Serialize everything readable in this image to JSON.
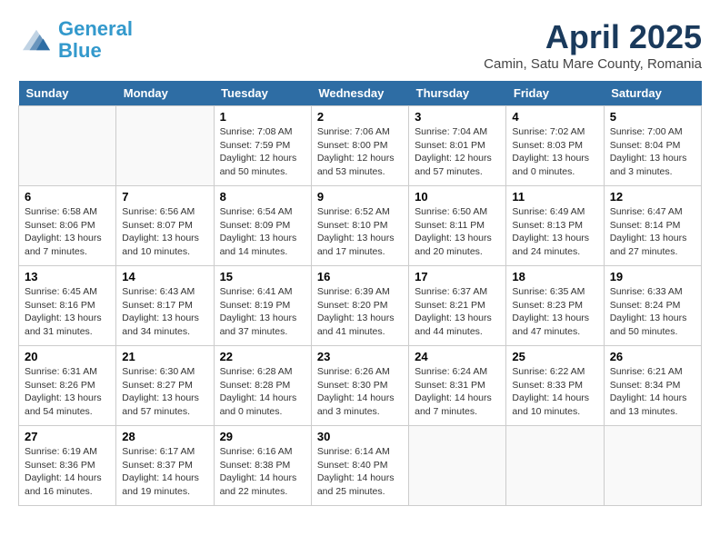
{
  "header": {
    "logo_line1": "General",
    "logo_line2": "Blue",
    "month_title": "April 2025",
    "location": "Camin, Satu Mare County, Romania"
  },
  "weekdays": [
    "Sunday",
    "Monday",
    "Tuesday",
    "Wednesday",
    "Thursday",
    "Friday",
    "Saturday"
  ],
  "weeks": [
    [
      {
        "day": "",
        "info": ""
      },
      {
        "day": "",
        "info": ""
      },
      {
        "day": "1",
        "info": "Sunrise: 7:08 AM\nSunset: 7:59 PM\nDaylight: 12 hours\nand 50 minutes."
      },
      {
        "day": "2",
        "info": "Sunrise: 7:06 AM\nSunset: 8:00 PM\nDaylight: 12 hours\nand 53 minutes."
      },
      {
        "day": "3",
        "info": "Sunrise: 7:04 AM\nSunset: 8:01 PM\nDaylight: 12 hours\nand 57 minutes."
      },
      {
        "day": "4",
        "info": "Sunrise: 7:02 AM\nSunset: 8:03 PM\nDaylight: 13 hours\nand 0 minutes."
      },
      {
        "day": "5",
        "info": "Sunrise: 7:00 AM\nSunset: 8:04 PM\nDaylight: 13 hours\nand 3 minutes."
      }
    ],
    [
      {
        "day": "6",
        "info": "Sunrise: 6:58 AM\nSunset: 8:06 PM\nDaylight: 13 hours\nand 7 minutes."
      },
      {
        "day": "7",
        "info": "Sunrise: 6:56 AM\nSunset: 8:07 PM\nDaylight: 13 hours\nand 10 minutes."
      },
      {
        "day": "8",
        "info": "Sunrise: 6:54 AM\nSunset: 8:09 PM\nDaylight: 13 hours\nand 14 minutes."
      },
      {
        "day": "9",
        "info": "Sunrise: 6:52 AM\nSunset: 8:10 PM\nDaylight: 13 hours\nand 17 minutes."
      },
      {
        "day": "10",
        "info": "Sunrise: 6:50 AM\nSunset: 8:11 PM\nDaylight: 13 hours\nand 20 minutes."
      },
      {
        "day": "11",
        "info": "Sunrise: 6:49 AM\nSunset: 8:13 PM\nDaylight: 13 hours\nand 24 minutes."
      },
      {
        "day": "12",
        "info": "Sunrise: 6:47 AM\nSunset: 8:14 PM\nDaylight: 13 hours\nand 27 minutes."
      }
    ],
    [
      {
        "day": "13",
        "info": "Sunrise: 6:45 AM\nSunset: 8:16 PM\nDaylight: 13 hours\nand 31 minutes."
      },
      {
        "day": "14",
        "info": "Sunrise: 6:43 AM\nSunset: 8:17 PM\nDaylight: 13 hours\nand 34 minutes."
      },
      {
        "day": "15",
        "info": "Sunrise: 6:41 AM\nSunset: 8:19 PM\nDaylight: 13 hours\nand 37 minutes."
      },
      {
        "day": "16",
        "info": "Sunrise: 6:39 AM\nSunset: 8:20 PM\nDaylight: 13 hours\nand 41 minutes."
      },
      {
        "day": "17",
        "info": "Sunrise: 6:37 AM\nSunset: 8:21 PM\nDaylight: 13 hours\nand 44 minutes."
      },
      {
        "day": "18",
        "info": "Sunrise: 6:35 AM\nSunset: 8:23 PM\nDaylight: 13 hours\nand 47 minutes."
      },
      {
        "day": "19",
        "info": "Sunrise: 6:33 AM\nSunset: 8:24 PM\nDaylight: 13 hours\nand 50 minutes."
      }
    ],
    [
      {
        "day": "20",
        "info": "Sunrise: 6:31 AM\nSunset: 8:26 PM\nDaylight: 13 hours\nand 54 minutes."
      },
      {
        "day": "21",
        "info": "Sunrise: 6:30 AM\nSunset: 8:27 PM\nDaylight: 13 hours\nand 57 minutes."
      },
      {
        "day": "22",
        "info": "Sunrise: 6:28 AM\nSunset: 8:28 PM\nDaylight: 14 hours\nand 0 minutes."
      },
      {
        "day": "23",
        "info": "Sunrise: 6:26 AM\nSunset: 8:30 PM\nDaylight: 14 hours\nand 3 minutes."
      },
      {
        "day": "24",
        "info": "Sunrise: 6:24 AM\nSunset: 8:31 PM\nDaylight: 14 hours\nand 7 minutes."
      },
      {
        "day": "25",
        "info": "Sunrise: 6:22 AM\nSunset: 8:33 PM\nDaylight: 14 hours\nand 10 minutes."
      },
      {
        "day": "26",
        "info": "Sunrise: 6:21 AM\nSunset: 8:34 PM\nDaylight: 14 hours\nand 13 minutes."
      }
    ],
    [
      {
        "day": "27",
        "info": "Sunrise: 6:19 AM\nSunset: 8:36 PM\nDaylight: 14 hours\nand 16 minutes."
      },
      {
        "day": "28",
        "info": "Sunrise: 6:17 AM\nSunset: 8:37 PM\nDaylight: 14 hours\nand 19 minutes."
      },
      {
        "day": "29",
        "info": "Sunrise: 6:16 AM\nSunset: 8:38 PM\nDaylight: 14 hours\nand 22 minutes."
      },
      {
        "day": "30",
        "info": "Sunrise: 6:14 AM\nSunset: 8:40 PM\nDaylight: 14 hours\nand 25 minutes."
      },
      {
        "day": "",
        "info": ""
      },
      {
        "day": "",
        "info": ""
      },
      {
        "day": "",
        "info": ""
      }
    ]
  ]
}
